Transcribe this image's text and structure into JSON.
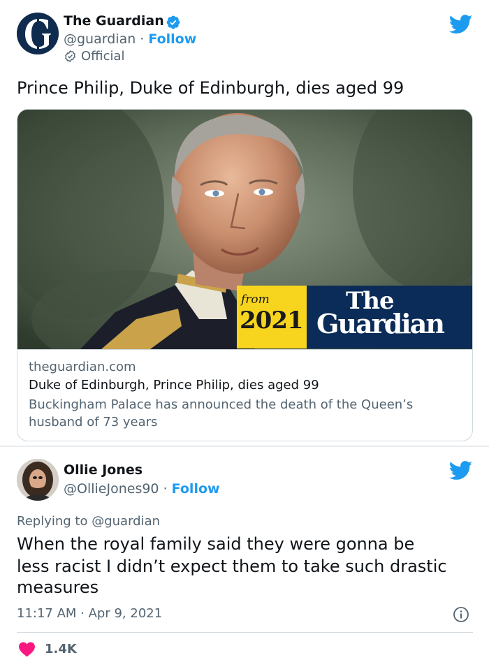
{
  "tweet1": {
    "author_name": "The Guardian",
    "handle": "@guardian",
    "separator": "·",
    "follow_label": "Follow",
    "official_label": "Official",
    "text": "Prince Philip, Duke of Edinburgh, dies aged 99",
    "card": {
      "banner_from": "from",
      "banner_year": "2021",
      "banner_brand_line1": "The",
      "banner_brand_line2": "Guardian",
      "domain": "theguardian.com",
      "title": "Duke of Edinburgh, Prince Philip, dies aged 99",
      "description": "Buckingham Palace has announced the death of the Queen’s husband of 73 years"
    }
  },
  "tweet2": {
    "author_name": "Ollie Jones",
    "handle": "@OllieJones90",
    "separator": "·",
    "follow_label": "Follow",
    "replying_to": "Replying to @guardian",
    "text_lines": [
      "When the royal family said they were gonna be",
      "less racist I didn’t expect them to take such drastic",
      "measures"
    ],
    "timestamp": "11:17 AM · Apr 9, 2021",
    "like_count": "1.4K"
  },
  "colors": {
    "twitter_blue": "#1d9bf0",
    "text_primary": "#0f1419",
    "text_secondary": "#536471",
    "heart_red": "#f91880",
    "guardian_blue": "#0b2c58",
    "banner_yellow": "#f7d51f"
  },
  "icons": [
    "guardian-logo-icon",
    "verified-badge-icon",
    "official-check-icon",
    "twitter-bird-icon",
    "info-icon",
    "heart-icon"
  ]
}
